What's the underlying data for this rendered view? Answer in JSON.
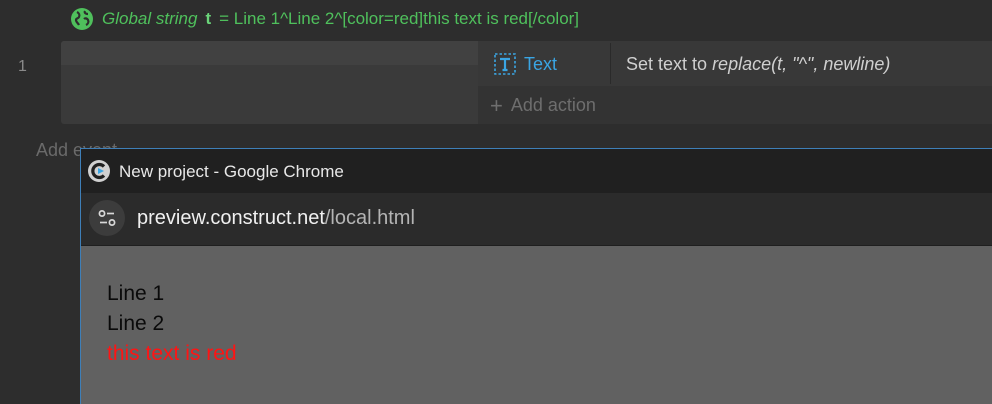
{
  "global_var": {
    "keyword": "Global string",
    "name": "t",
    "assignment": "= Line 1^Line 2^[color=red]this text is red[/color]",
    "icon": "globe-icon",
    "color": "#4fc05c"
  },
  "event": {
    "row_number": "1"
  },
  "action": {
    "object_icon": "text-object-icon",
    "object_name": "Text",
    "description_prefix": "Set text to",
    "expression": "replace(t, \"^\", newline)",
    "object_color": "#3aa5e3"
  },
  "add_action_label": "Add action",
  "add_event_label": "Add event",
  "browser": {
    "app_icon": "construct-icon",
    "title": "New project - Google Chrome",
    "url_host": "preview.construct.net",
    "url_path": "/local.html",
    "site_info_icon": "site-info-icon"
  },
  "preview": {
    "lines": [
      "Line 1",
      "Line 2"
    ],
    "red_line": "this text is red",
    "red_color": "#ff1414"
  }
}
